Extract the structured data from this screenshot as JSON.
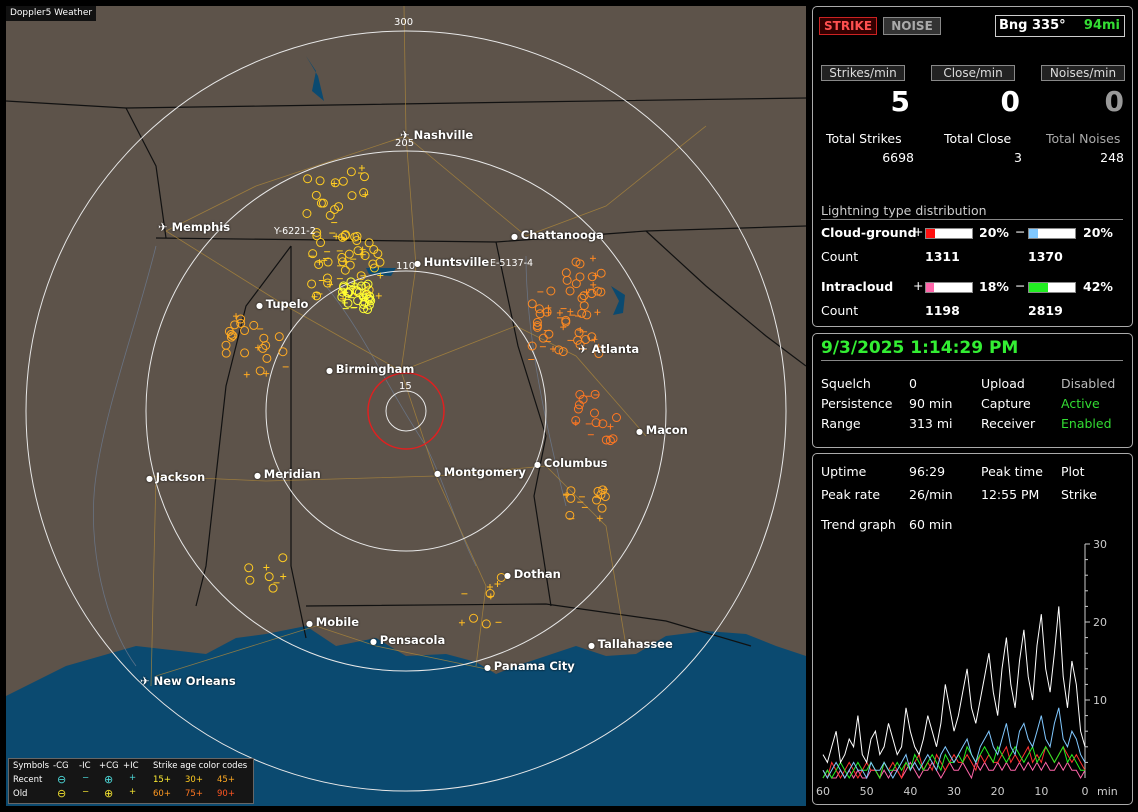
{
  "map": {
    "title": "Doppler5 Weather",
    "range_labels": [
      "300",
      "205",
      "110",
      "15"
    ],
    "fixes": [
      "Y-6221-2",
      "E-5137-4"
    ],
    "cities": [
      {
        "name": "Nashville",
        "airport": true
      },
      {
        "name": "Memphis",
        "airport": true
      },
      {
        "name": "Chattanooga",
        "airport": false
      },
      {
        "name": "Huntsville",
        "airport": false
      },
      {
        "name": "Tupelo",
        "airport": false
      },
      {
        "name": "Atlanta",
        "airport": true
      },
      {
        "name": "Birmingham",
        "airport": false
      },
      {
        "name": "Macon",
        "airport": false
      },
      {
        "name": "Jackson",
        "airport": false
      },
      {
        "name": "Meridian",
        "airport": false
      },
      {
        "name": "Montgomery",
        "airport": false
      },
      {
        "name": "Columbus",
        "airport": false
      },
      {
        "name": "Dothan",
        "airport": false
      },
      {
        "name": "Mobile",
        "airport": false
      },
      {
        "name": "Pensacola",
        "airport": false
      },
      {
        "name": "Tallahassee",
        "airport": false
      },
      {
        "name": "Panama City",
        "airport": false
      },
      {
        "name": "New Orleans",
        "airport": true
      }
    ],
    "legend": {
      "header_symbols": "Symbols",
      "col_labels": [
        "-CG",
        "-IC",
        "+CG",
        "+IC"
      ],
      "row_recent": "Recent",
      "row_old": "Old",
      "age_title": "Strike age color codes",
      "ages_recent": [
        "15+",
        "30+",
        "45+"
      ],
      "ages_old": [
        "60+",
        "75+",
        "90+"
      ]
    }
  },
  "mode": {
    "strike": "STRIKE",
    "noise": "NOISE"
  },
  "bearing": {
    "label": "Bng 335°",
    "distance": "94mi"
  },
  "rates": [
    {
      "label": "Strikes/min",
      "value": "5"
    },
    {
      "label": "Close/min",
      "value": "0"
    },
    {
      "label": "Noises/min",
      "value": "0"
    }
  ],
  "totals": [
    {
      "label": "Total Strikes",
      "value": "6698"
    },
    {
      "label": "Total Close",
      "value": "3"
    },
    {
      "label": "Total Noises",
      "value": "248"
    }
  ],
  "distribution": {
    "title": "Lightning type distribution",
    "cg": {
      "label": "Cloud-ground",
      "pos_pct": "20%",
      "neg_pct": "20%",
      "pos_fill": 0.2,
      "neg_fill": 0.2,
      "count_label": "Count",
      "pos_count": "1311",
      "neg_count": "1370"
    },
    "ic": {
      "label": "Intracloud",
      "pos_pct": "18%",
      "neg_pct": "42%",
      "pos_fill": 0.18,
      "neg_fill": 0.42,
      "count_label": "Count",
      "pos_count": "1198",
      "neg_count": "2819"
    },
    "plus": "+",
    "minus": "−",
    "colors": {
      "cg_pos": "#ff1010",
      "cg_neg": "#80c8ff",
      "ic_pos": "#ff66aa",
      "ic_neg": "#22ee22"
    }
  },
  "status": {
    "datetime": "9/3/2025 1:14:29 PM",
    "rows": [
      {
        "label": "Squelch",
        "value": "0",
        "label2": "Upload",
        "value2": "Disabled",
        "color2": "#bbbbbb"
      },
      {
        "label": "Persistence",
        "value": "90 min",
        "label2": "Capture",
        "value2": "Active",
        "color2": "#33dd33"
      },
      {
        "label": "Range",
        "value": "313 mi",
        "label2": "Receiver",
        "value2": "Enabled",
        "color2": "#33dd33"
      }
    ]
  },
  "stats": {
    "uptime_label": "Uptime",
    "uptime": "96:29",
    "peaktime_label": "Peak time",
    "peaktime": "12:55 PM",
    "plot_label": "Plot",
    "plot": "Strike",
    "peakrate_label": "Peak rate",
    "peakrate": "26/min",
    "trend_label": "Trend graph",
    "trend": "60 min"
  },
  "chart_data": {
    "type": "line",
    "x_ticks": [
      "60",
      "50",
      "40",
      "30",
      "20",
      "10",
      "0"
    ],
    "xlabel": "min",
    "y_ticks": [
      "30",
      "20",
      "10"
    ],
    "ylim": [
      0,
      30
    ],
    "xlim": [
      60,
      0
    ],
    "series": [
      {
        "color": "#ffffff",
        "values": [
          3,
          2,
          4,
          6,
          2,
          3,
          5,
          4,
          8,
          3,
          2,
          5,
          6,
          3,
          4,
          7,
          5,
          3,
          4,
          9,
          6,
          4,
          3,
          5,
          8,
          6,
          4,
          7,
          12,
          9,
          6,
          8,
          11,
          14,
          9,
          7,
          10,
          13,
          16,
          11,
          8,
          14,
          18,
          12,
          9,
          15,
          19,
          13,
          10,
          17,
          21,
          14,
          11,
          16,
          22,
          13,
          9,
          15,
          12,
          6,
          4
        ]
      },
      {
        "color": "#80c8ff",
        "values": [
          1,
          0,
          1,
          2,
          1,
          0,
          1,
          2,
          1,
          1,
          0,
          2,
          1,
          1,
          2,
          1,
          0,
          1,
          2,
          3,
          1,
          2,
          1,
          2,
          3,
          2,
          1,
          3,
          4,
          3,
          2,
          3,
          4,
          5,
          3,
          2,
          4,
          5,
          6,
          4,
          3,
          5,
          7,
          4,
          3,
          6,
          7,
          5,
          4,
          6,
          8,
          5,
          4,
          7,
          9,
          5,
          4,
          6,
          5,
          3,
          2
        ]
      },
      {
        "color": "#22ee22",
        "values": [
          0,
          1,
          0,
          1,
          2,
          1,
          0,
          1,
          2,
          1,
          1,
          2,
          1,
          0,
          2,
          1,
          1,
          2,
          1,
          2,
          1,
          3,
          2,
          1,
          2,
          3,
          2,
          1,
          3,
          2,
          2,
          3,
          2,
          4,
          3,
          2,
          3,
          4,
          3,
          2,
          4,
          3,
          2,
          3,
          4,
          3,
          2,
          3,
          4,
          2,
          3,
          4,
          3,
          2,
          3,
          4,
          2,
          3,
          2,
          1,
          1
        ]
      },
      {
        "color": "#ff3030",
        "values": [
          1,
          0,
          2,
          1,
          0,
          1,
          2,
          1,
          0,
          1,
          2,
          1,
          1,
          0,
          2,
          1,
          2,
          1,
          0,
          2,
          1,
          2,
          3,
          1,
          2,
          1,
          3,
          2,
          1,
          2,
          3,
          2,
          2,
          3,
          2,
          1,
          3,
          2,
          3,
          2,
          2,
          3,
          4,
          2,
          3,
          2,
          3,
          4,
          2,
          3,
          2,
          4,
          3,
          2,
          3,
          4,
          3,
          2,
          3,
          2,
          1
        ]
      },
      {
        "color": "#ff66aa",
        "values": [
          0,
          1,
          0,
          0,
          1,
          0,
          1,
          0,
          1,
          0,
          0,
          1,
          1,
          0,
          1,
          0,
          1,
          1,
          0,
          1,
          2,
          1,
          0,
          1,
          1,
          2,
          1,
          0,
          1,
          2,
          1,
          1,
          2,
          1,
          0,
          2,
          1,
          2,
          1,
          1,
          2,
          1,
          2,
          1,
          1,
          2,
          1,
          2,
          1,
          2,
          1,
          2,
          1,
          1,
          2,
          1,
          2,
          1,
          1,
          0,
          1
        ]
      }
    ]
  }
}
